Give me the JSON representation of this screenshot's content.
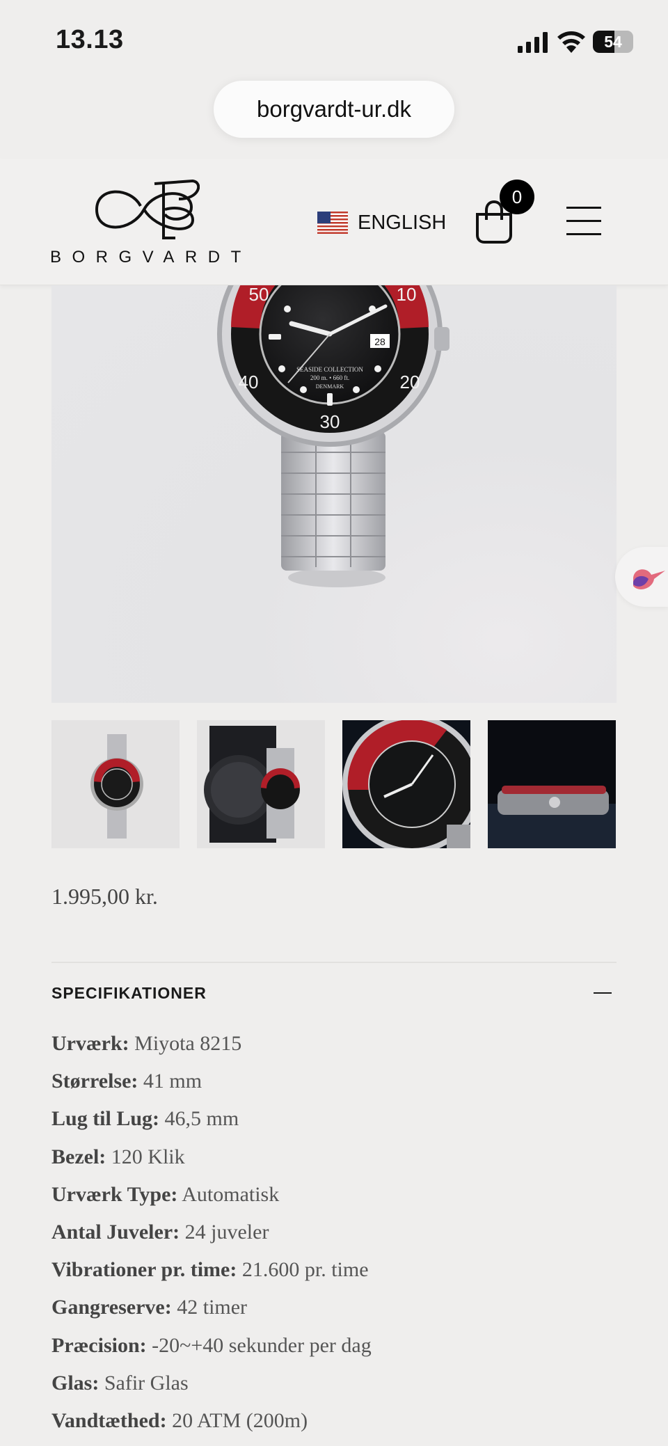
{
  "status_bar": {
    "time": "13.13",
    "battery": "54",
    "battery_level": 0.54
  },
  "browser": {
    "url": "borgvardt-ur.dk"
  },
  "header": {
    "brand": "BORGVARDT",
    "language": "ENGLISH",
    "cart_count": "0",
    "icons": [
      "us-flag-icon",
      "shopping-bag-icon",
      "hamburger-menu-icon"
    ]
  },
  "product": {
    "price": "1.995,00 kr.",
    "watch_markings": [
      "SEASIDE COLLECTION",
      "200 m. • 660 ft.",
      "DENMARK"
    ],
    "bezel_numbers": [
      "50",
      "10",
      "40",
      "20",
      "30"
    ],
    "date": "28",
    "colors": {
      "bezel_red": "#b01e28",
      "dial": "#111111",
      "steel": "#c8c8cc"
    }
  },
  "specs": {
    "title": "SPECIFIKATIONER",
    "items": [
      {
        "label": "Urværk:",
        "value": " Miyota 8215"
      },
      {
        "label": "Størrelse:",
        "value": " 41 mm"
      },
      {
        "label": "Lug til Lug:",
        "value": " 46,5 mm"
      },
      {
        "label": "Bezel:",
        "value": " 120 Klik"
      },
      {
        "label": "Urværk Type:",
        "value": " Automatisk"
      },
      {
        "label": "Antal Juveler:",
        "value": " 24 juveler"
      },
      {
        "label": "Vibrationer pr. time:",
        "value": " 21.600 pr. time"
      },
      {
        "label": "Gangreserve:",
        "value": " 42 timer"
      },
      {
        "label": "Præcision:",
        "value": " -20~+40 sekunder per dag"
      },
      {
        "label": "Glas:",
        "value": " Safir Glas"
      },
      {
        "label": "Vandtæthed:",
        "value": " 20 ATM (200m)"
      }
    ]
  }
}
